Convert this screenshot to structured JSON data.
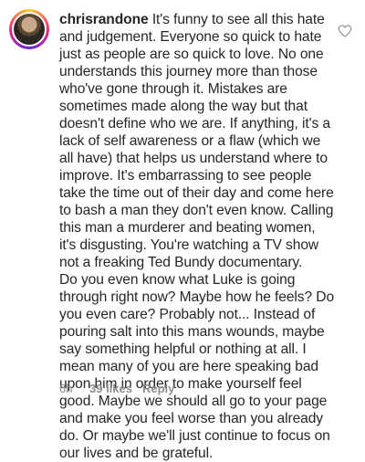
{
  "comment": {
    "username": "chrisrandone",
    "body": "It's funny to see all this hate and judgement. Everyone so quick to hate just as people are so quick to love. No one understands this journey more than those who've gone through it. Mistakes are sometimes made along the way but that doesn't define who we are. If anything, it's a lack of self awareness or a flaw (which we all have) that helps us understand where to improve. It's embarrassing to see people take the time out of their day and come here to bash a man they don't even know. Calling this man a murderer and beating women, it's disgusting. You're watching a TV show not a freaking Ted Bundy documentary.\nDo you even know what Luke is going through right now? Maybe how he feels? Do you even care? Probably not... Instead of pouring salt into this mans wounds, maybe say something helpful or nothing at all. I mean many of you are here speaking bad upon him in order to make yourself feel good. Maybe we should all go to your page and make you feel worse than you already do. Or maybe we'll just continue to focus on our lives and be grateful.",
    "time": "6h",
    "likes": "39 likes",
    "reply_label": "Reply",
    "icons": {
      "avatar": "avatar",
      "like": "heart-outline-icon"
    }
  }
}
